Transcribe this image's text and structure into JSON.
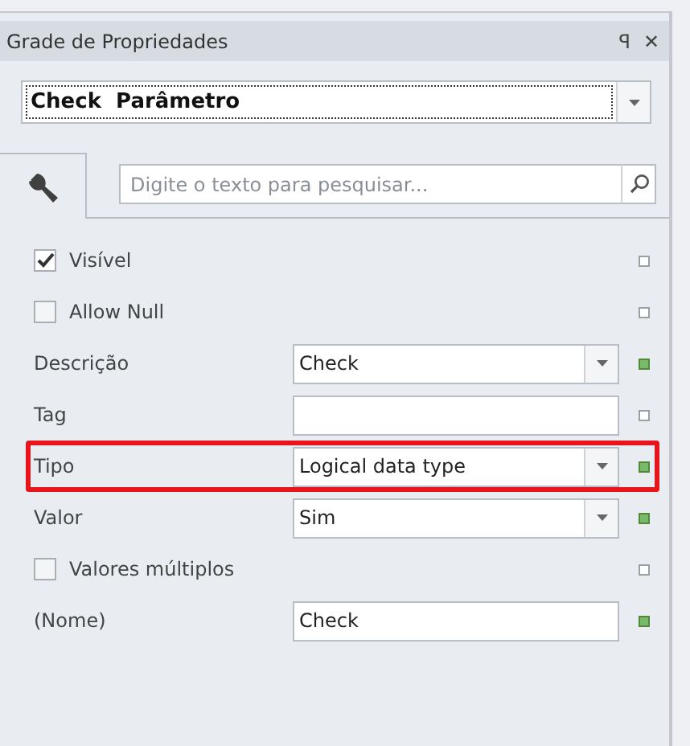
{
  "panel": {
    "title": "Grade de Propriedades",
    "pin": "ꟼ",
    "close": "✕"
  },
  "object_selector": {
    "value": "Check  Parâmetro"
  },
  "search": {
    "placeholder": "Digite o texto para pesquisar..."
  },
  "properties": [
    {
      "kind": "checkbox",
      "label": "Visível",
      "checked": true,
      "modified": false,
      "highlighted": false
    },
    {
      "kind": "checkbox",
      "label": "Allow Null",
      "checked": false,
      "modified": false,
      "highlighted": false
    },
    {
      "kind": "combo",
      "label": "Descrição",
      "value": "Check",
      "modified": true,
      "highlighted": false
    },
    {
      "kind": "text",
      "label": "Tag",
      "modified": false,
      "highlighted": false
    },
    {
      "kind": "combo",
      "label": "Tipo",
      "value": "Logical data type",
      "modified": true,
      "highlighted": true
    },
    {
      "kind": "combo",
      "label": "Valor",
      "value": "Sim",
      "modified": true,
      "highlighted": false
    },
    {
      "kind": "checkbox",
      "label": "Valores múltiplos",
      "checked": false,
      "modified": false,
      "highlighted": false
    },
    {
      "kind": "text",
      "label": "(Nome)",
      "value": "Check",
      "modified": true,
      "highlighted": false
    }
  ]
}
